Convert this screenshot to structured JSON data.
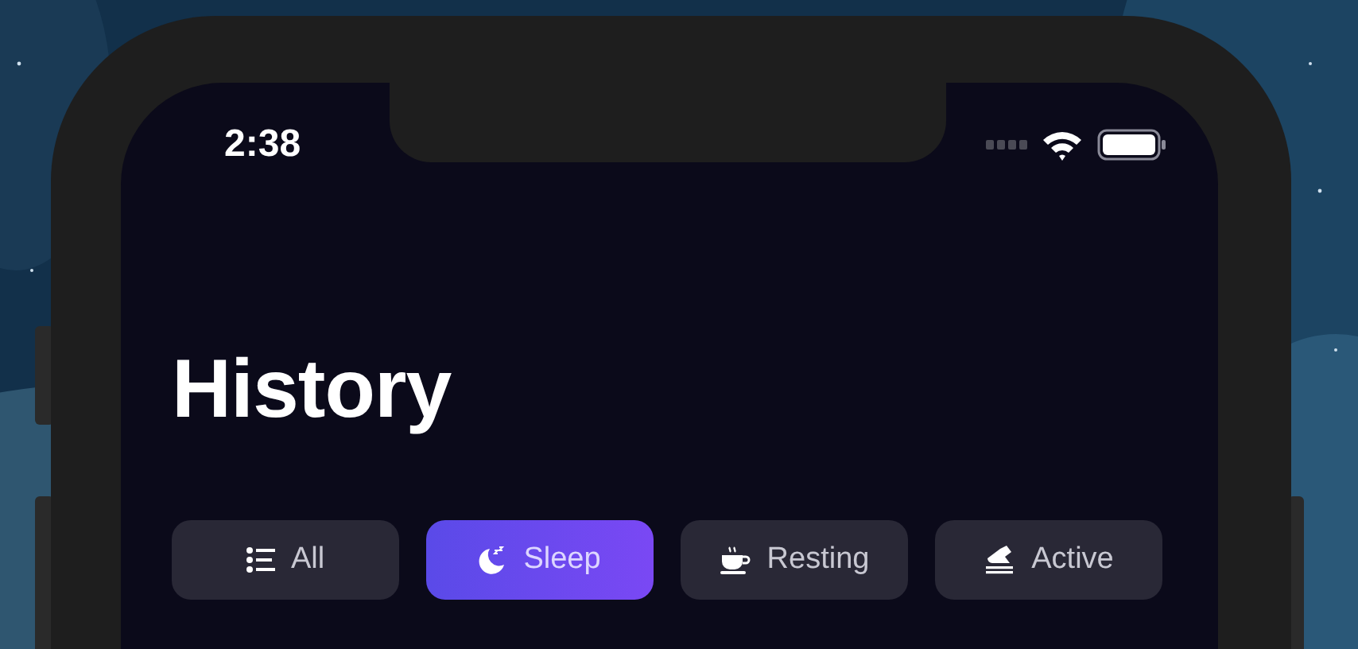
{
  "status_bar": {
    "time": "2:38"
  },
  "title": "History",
  "tabs": [
    {
      "label": "All",
      "selected": false
    },
    {
      "label": "Sleep",
      "selected": true
    },
    {
      "label": "Resting",
      "selected": false
    },
    {
      "label": "Active",
      "selected": false
    }
  ]
}
